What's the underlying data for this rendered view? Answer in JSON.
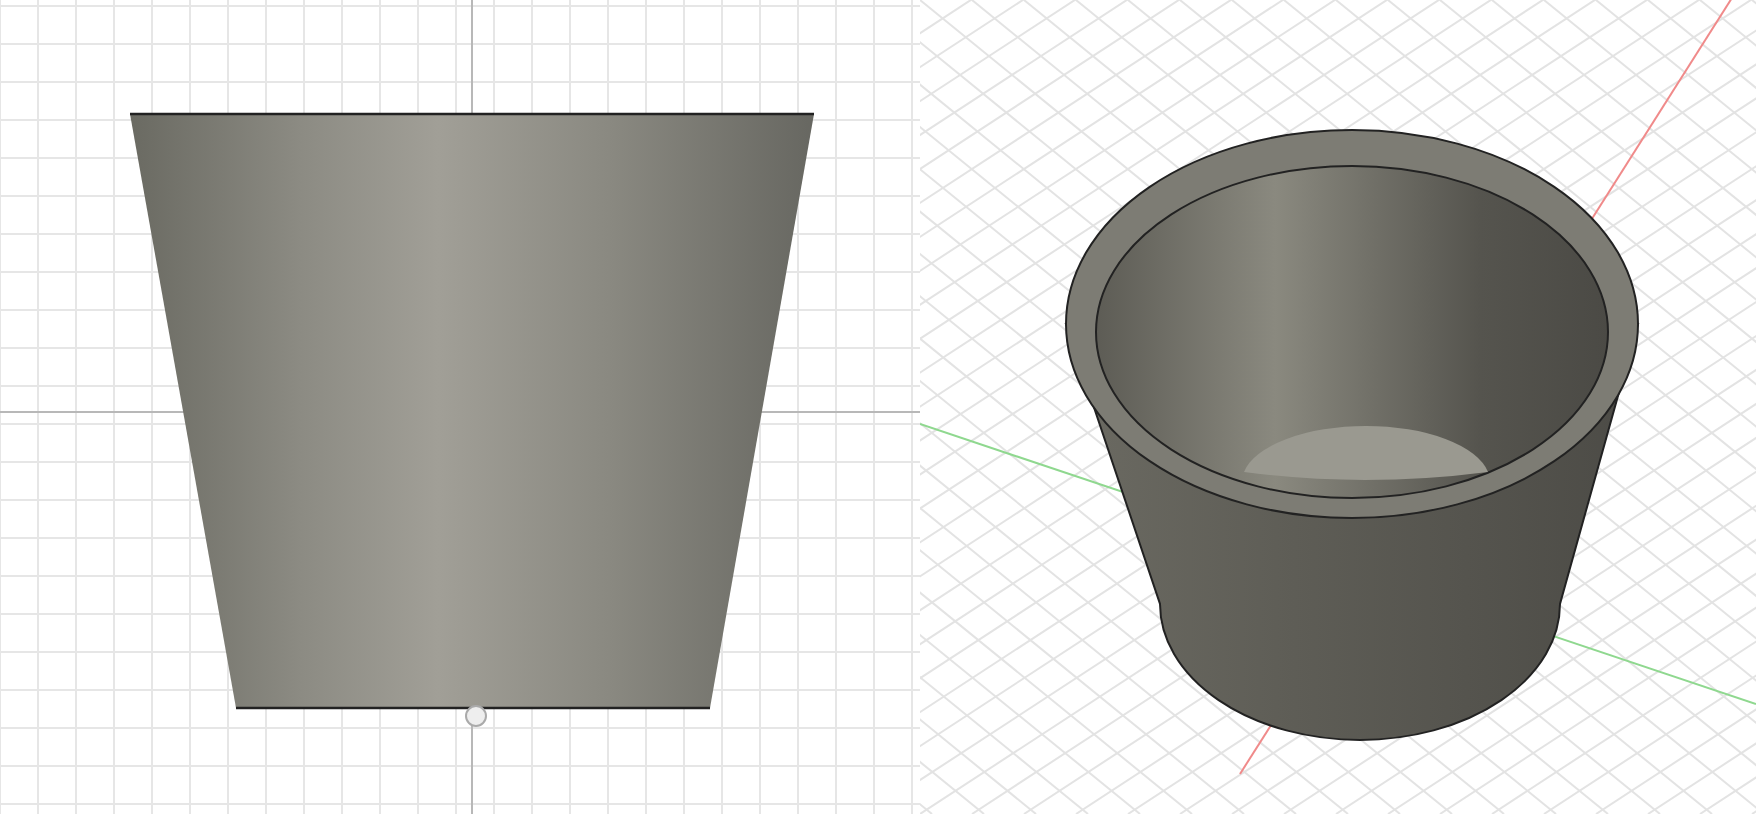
{
  "viewports": [
    {
      "kind": "front"
    },
    {
      "kind": "isometric"
    }
  ]
}
